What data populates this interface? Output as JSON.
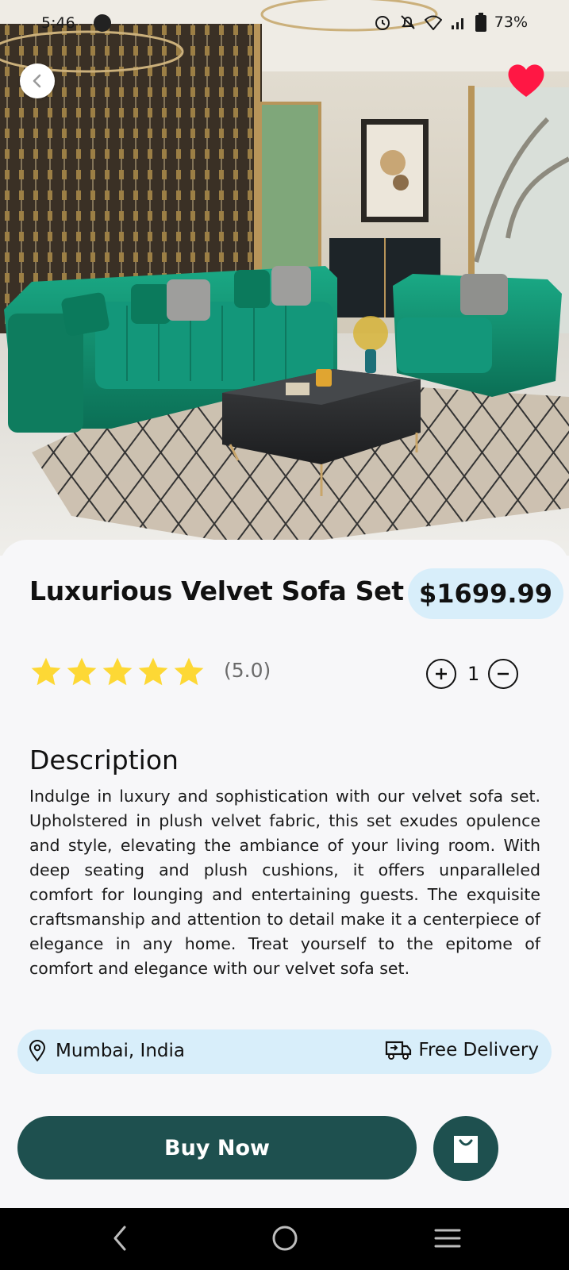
{
  "status_bar": {
    "time": "5:46",
    "battery": "73%",
    "icons": [
      "app-notification-icon",
      "alarm-icon",
      "mute-icon",
      "wifi-icon",
      "signal-icon",
      "battery-icon"
    ]
  },
  "hero": {
    "image_subject": "living-room-velvet-sofa-photo",
    "back_icon": "chevron-left-icon",
    "favorite_icon": "heart-icon",
    "favorite_color": "#ff1744"
  },
  "product": {
    "title": "Luxurious Velvet Sofa Set",
    "price": "$1699.99",
    "rating_value": 5,
    "rating_max": 5,
    "rating_text": "(5.0)",
    "quantity": "1",
    "star_color": "#fdd835"
  },
  "description": {
    "heading": "Description",
    "text": "Indulge in luxury and sophistication with our velvet sofa set. Upholstered in plush velvet fabric, this set exudes opulence and style, elevating the ambiance of your living room. With deep seating and plush cushions, it offers unparalleled comfort for lounging and entertaining guests. The exquisite craftsmanship and attention to detail make it a centerpiece of elegance in any home. Treat yourself to the epitome of comfort and elegance with our velvet sofa set."
  },
  "info": {
    "location": "Mumbai, India",
    "delivery": "Free Delivery",
    "pill_color": "#d8eefa"
  },
  "actions": {
    "buy_label": "Buy Now",
    "cart_icon": "shopping-bag-icon",
    "primary_color": "#1e504f"
  },
  "nav": {
    "icons": [
      "nav-back-icon",
      "nav-home-icon",
      "nav-recents-icon"
    ]
  }
}
